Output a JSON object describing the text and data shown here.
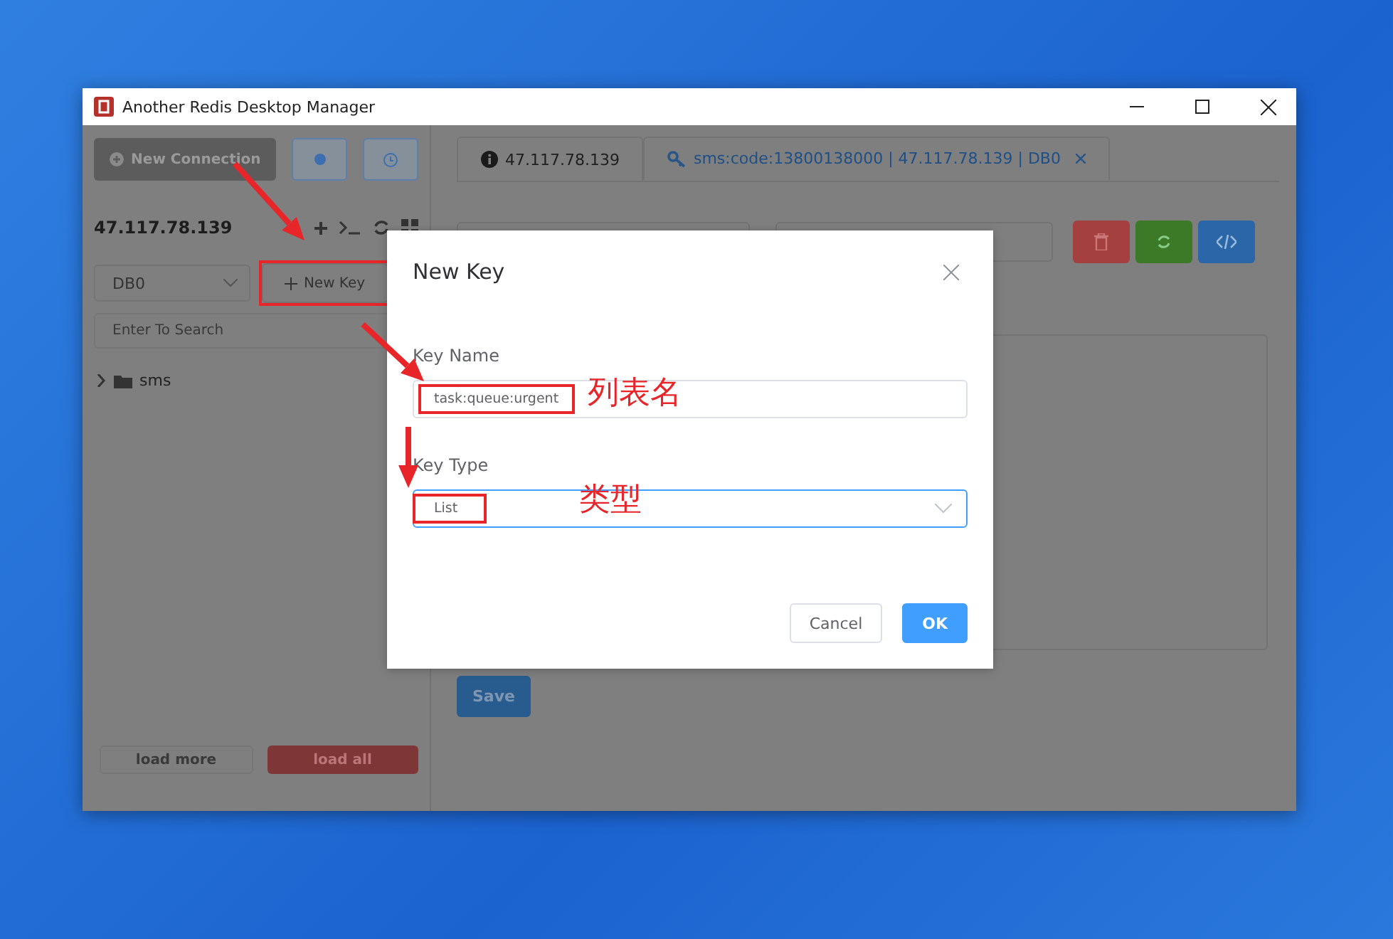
{
  "window": {
    "title": "Another Redis Desktop Manager"
  },
  "sidebar": {
    "new_connection": "New Connection",
    "host": "47.117.78.139",
    "db_select": "DB0",
    "new_key": "New Key",
    "search": {
      "placeholder": "Enter To Search"
    },
    "tree": [
      {
        "label": "sms",
        "expanded": false
      }
    ],
    "load_more": "load more",
    "load_all": "load all"
  },
  "tabs": [
    {
      "label": "47.117.78.139",
      "kind": "info",
      "selected": false,
      "closable": false
    },
    {
      "label": "sms:code:13800138000 | 47.117.78.139 | DB0",
      "kind": "key",
      "selected": true,
      "closable": true
    }
  ],
  "editor": {
    "save": "Save"
  },
  "dialog": {
    "title": "New Key",
    "fields": [
      {
        "label": "Key Name",
        "kind": "input",
        "value": "task:queue:urgent",
        "focused": false
      },
      {
        "label": "Key Type",
        "kind": "select",
        "value": "List",
        "focused": true
      }
    ],
    "buttons": [
      {
        "label": "Cancel",
        "kind": "secondary"
      },
      {
        "label": "OK",
        "kind": "primary"
      }
    ]
  },
  "annotations": [
    {
      "text": "列表名"
    },
    {
      "text": "类型"
    }
  ]
}
